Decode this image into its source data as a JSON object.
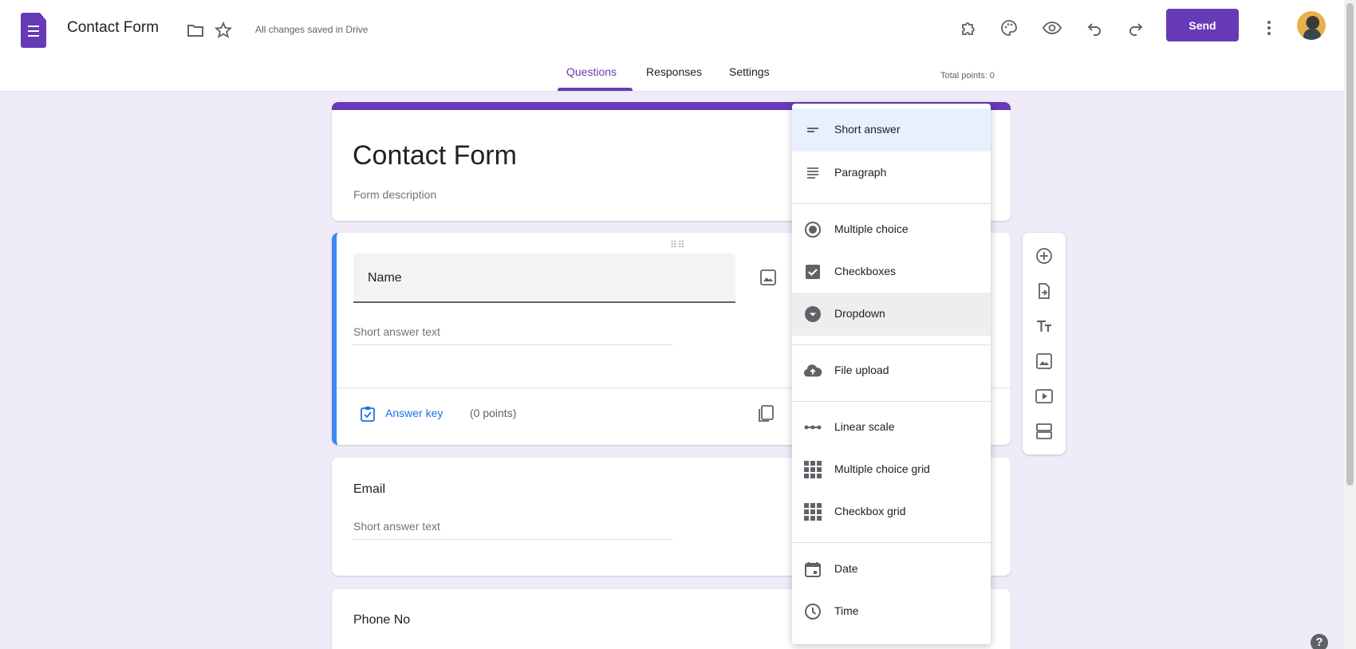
{
  "header": {
    "title": "Contact Form",
    "saved_status": "All changes saved in Drive",
    "send_label": "Send",
    "icons": [
      "addon-icon",
      "palette-icon",
      "preview-eye-icon",
      "undo-icon",
      "redo-icon",
      "more-vert-icon"
    ]
  },
  "tabs": [
    {
      "label": "Questions",
      "active": true
    },
    {
      "label": "Responses",
      "active": false
    },
    {
      "label": "Settings",
      "active": false
    }
  ],
  "total_points": "Total points: 0",
  "form": {
    "title": "Contact Form",
    "description_placeholder": "Form description"
  },
  "questions": [
    {
      "title": "Name",
      "answer_placeholder": "Short answer text",
      "answer_key_label": "Answer key",
      "points_label": "(0 points)"
    },
    {
      "title": "Email",
      "answer_placeholder": "Short answer text"
    },
    {
      "title": "Phone No"
    }
  ],
  "question_type_menu": [
    {
      "label": "Short answer",
      "icon": "short-answer-icon",
      "highlighted": "selected"
    },
    {
      "label": "Paragraph",
      "icon": "paragraph-icon"
    },
    {
      "label": "Multiple choice",
      "icon": "radio-icon"
    },
    {
      "label": "Checkboxes",
      "icon": "checkbox-icon"
    },
    {
      "label": "Dropdown",
      "icon": "dropdown-icon",
      "highlighted": "hover"
    },
    {
      "label": "File upload",
      "icon": "cloud-upload-icon"
    },
    {
      "label": "Linear scale",
      "icon": "linear-scale-icon"
    },
    {
      "label": "Multiple choice grid",
      "icon": "grid-icon"
    },
    {
      "label": "Checkbox grid",
      "icon": "grid-icon"
    },
    {
      "label": "Date",
      "icon": "calendar-icon"
    },
    {
      "label": "Time",
      "icon": "clock-icon"
    }
  ],
  "side_toolbar": [
    "add-question-icon",
    "import-questions-icon",
    "add-title-icon",
    "add-image-icon",
    "add-video-icon",
    "add-section-icon"
  ],
  "colors": {
    "accent": "#673ab7",
    "background": "#f0ebf8",
    "active_border": "#4285f4"
  }
}
